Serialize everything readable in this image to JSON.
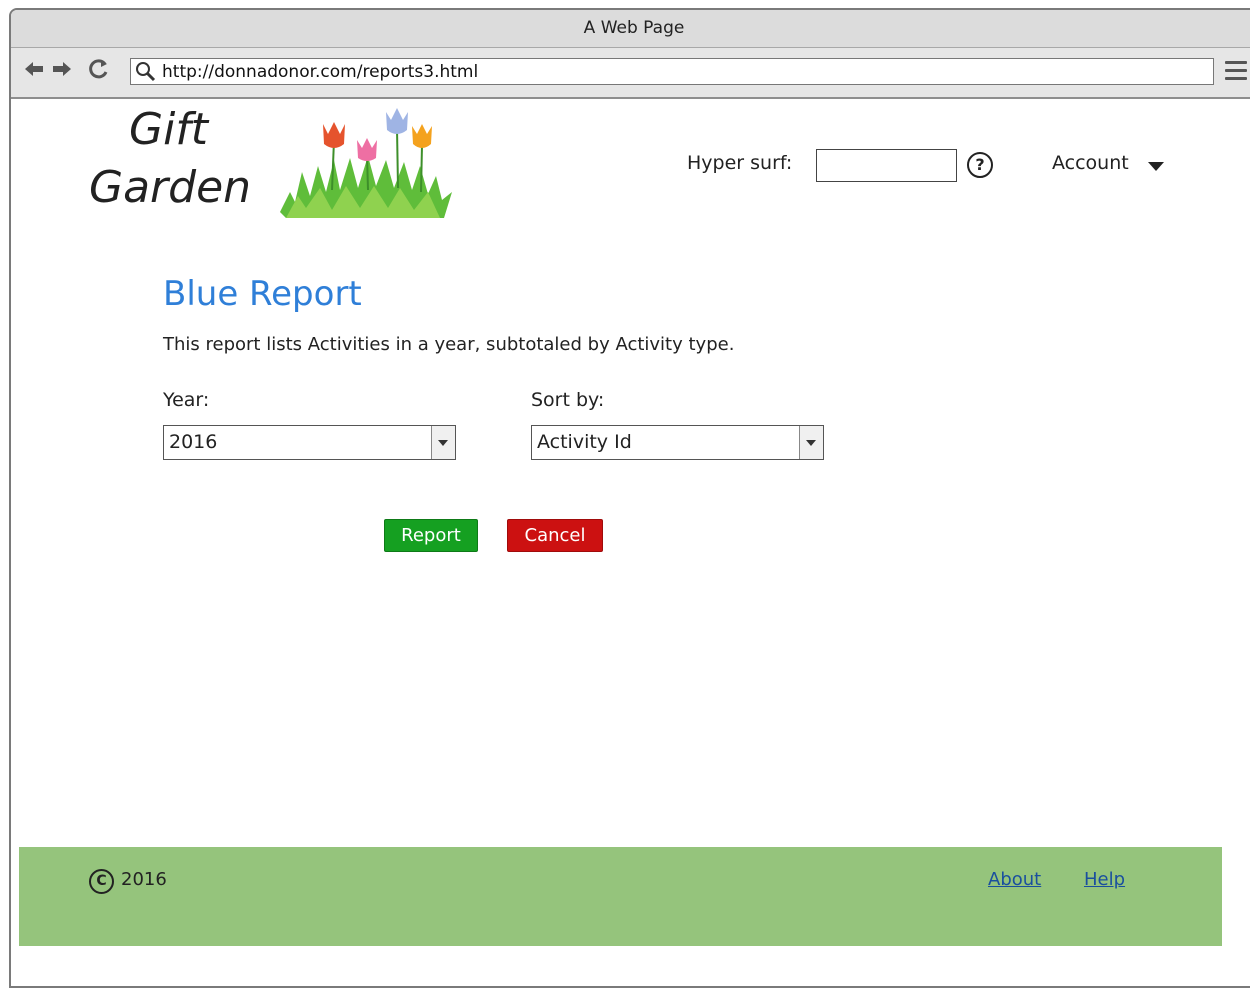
{
  "window": {
    "title": "A Web Page",
    "url": "http://donnadonor.com/reports3.html"
  },
  "nav": {
    "back_icon": "back-arrow-icon",
    "forward_icon": "forward-arrow-icon",
    "reload_icon": "reload-icon",
    "search_icon": "search-icon",
    "menu_icon": "hamburger-menu-icon"
  },
  "header": {
    "logo_line1": "Gift",
    "logo_line2": "Garden",
    "hypersurf_label": "Hyper surf:",
    "hypersurf_value": "",
    "help_glyph": "?",
    "account_label": "Account"
  },
  "report": {
    "title": "Blue Report",
    "description": "This report lists Activities in a year, subtotaled by Activity type.",
    "year_label": "Year:",
    "year_value": "2016",
    "sort_label": "Sort by:",
    "sort_value": "Activity Id",
    "report_button": "Report",
    "cancel_button": "Cancel"
  },
  "footer": {
    "copyright_glyph": "C",
    "year": "2016",
    "about": "About",
    "help": "Help"
  },
  "colors": {
    "title_blue": "#2f7fd8",
    "report_green": "#15a021",
    "cancel_red": "#cc1111",
    "footer_green": "#95c47c"
  }
}
